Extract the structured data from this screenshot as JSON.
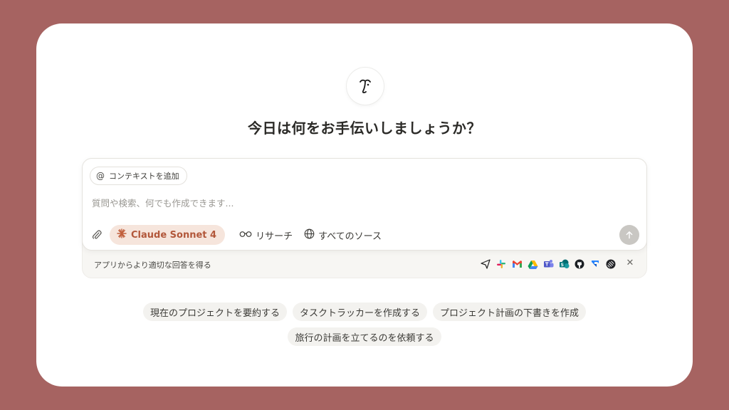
{
  "heading": "今日は何をお手伝いしましょうか？",
  "composer": {
    "context_label": "コンテキストを追加",
    "placeholder": "質問や検索、何でも作成できます...",
    "model_label": "Claude Sonnet 4",
    "research_label": "リサーチ",
    "sources_label": "すべてのソース"
  },
  "apps_bar": {
    "label": "アプリからより適切な回答を得る",
    "icons": [
      "paper-plane-icon",
      "slack-icon",
      "gmail-icon",
      "google-drive-icon",
      "teams-icon",
      "sharepoint-icon",
      "github-icon",
      "jira-icon",
      "linear-icon"
    ]
  },
  "suggestions": {
    "row1": [
      "現在のプロジェクトを要約する",
      "タスクトラッカーを作成する",
      "プロジェクト計画の下書きを作成"
    ],
    "row2": [
      "旅行の計画を立てるのを依頼する"
    ]
  },
  "colors": {
    "background": "#a66361",
    "accent": "#b2573a",
    "model_pill_bg": "#f6e5dc"
  }
}
